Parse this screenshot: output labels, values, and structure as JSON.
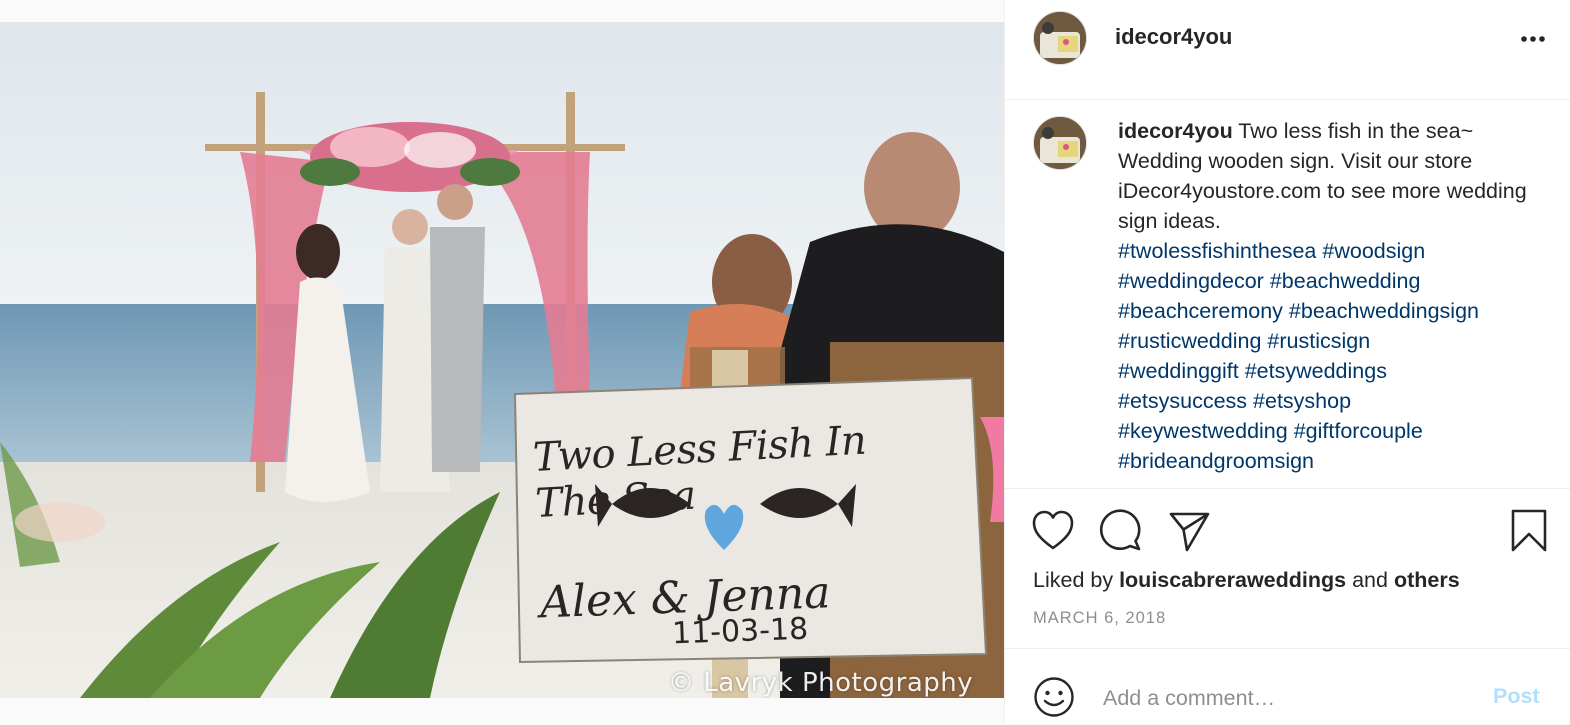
{
  "post": {
    "image": {
      "sign_title": "Two Less Fish In The Sea",
      "sign_names": "Alex & Jenna",
      "sign_date": "11-03-18",
      "credit": "© Lavryk Photography"
    },
    "header": {
      "username": "idecor4you",
      "more_icon": "more-horizontal-icon"
    },
    "caption": {
      "username": "idecor4you",
      "text": "Two less fish in the sea~ Wedding wooden sign. Visit our store iDecor4youstore.com to see more wedding sign ideas.",
      "hashtags": [
        "#twolessfishinthesea",
        "#woodsign",
        "#weddingdecor",
        "#beachwedding",
        "#beachceremony",
        "#beachweddingsign",
        "#rusticwedding",
        "#rusticsign",
        "#weddinggift",
        "#etsyweddings",
        "#etsysuccess",
        "#etsyshop",
        "#keywestwedding",
        "#giftforcouple",
        "#brideandgroomsign"
      ]
    },
    "actions": {
      "like_icon": "heart-icon",
      "comment_icon": "comment-icon",
      "share_icon": "share-icon",
      "save_icon": "bookmark-icon"
    },
    "likes": {
      "prefix": "Liked by",
      "user": "louiscabreraweddings",
      "joiner": "and",
      "others": "others"
    },
    "date": "MARCH 6, 2018",
    "comment_box": {
      "emoji_icon": "emoji-smile-icon",
      "placeholder": "Add a comment…",
      "post_label": "Post"
    },
    "colors": {
      "link": "#00376b",
      "post_disabled": "#b2dffc",
      "muted": "#8e8e8e",
      "text": "#262626"
    }
  }
}
